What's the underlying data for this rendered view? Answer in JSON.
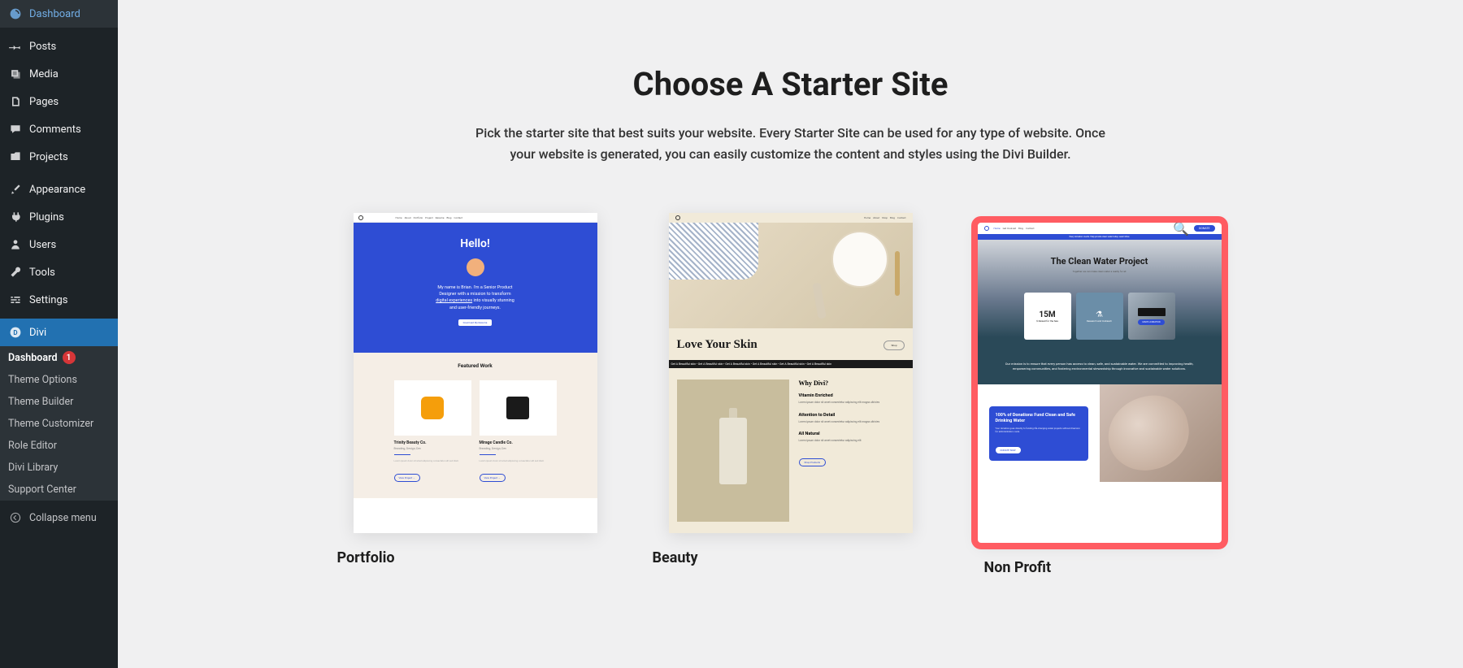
{
  "sidebar": {
    "items": [
      {
        "label": "Dashboard",
        "icon": "gauge"
      },
      {
        "label": "Posts",
        "icon": "pin"
      },
      {
        "label": "Media",
        "icon": "media"
      },
      {
        "label": "Pages",
        "icon": "pages"
      },
      {
        "label": "Comments",
        "icon": "comment"
      },
      {
        "label": "Projects",
        "icon": "projects"
      },
      {
        "label": "Appearance",
        "icon": "brush"
      },
      {
        "label": "Plugins",
        "icon": "plug"
      },
      {
        "label": "Users",
        "icon": "user"
      },
      {
        "label": "Tools",
        "icon": "wrench"
      },
      {
        "label": "Settings",
        "icon": "sliders"
      },
      {
        "label": "Divi",
        "icon": "divi"
      }
    ],
    "submenu": [
      {
        "label": "Dashboard",
        "badge": "1"
      },
      {
        "label": "Theme Options"
      },
      {
        "label": "Theme Builder"
      },
      {
        "label": "Theme Customizer"
      },
      {
        "label": "Role Editor"
      },
      {
        "label": "Divi Library"
      },
      {
        "label": "Support Center"
      }
    ],
    "collapse": "Collapse menu"
  },
  "page": {
    "title": "Choose A Starter Site",
    "description": "Pick the starter site that best suits your website. Every Starter Site can be used for any type of website. Once your website is generated, you can easily customize the content and styles using the Divi Builder."
  },
  "cards": [
    {
      "label": "Portfolio",
      "selected": false
    },
    {
      "label": "Beauty",
      "selected": false
    },
    {
      "label": "Non Profit",
      "selected": true
    }
  ],
  "thumb_portfolio": {
    "nav": [
      "Home",
      "About",
      "Portfolio",
      "Project",
      "Resume",
      "Blog",
      "Contact"
    ],
    "hello": "Hello!",
    "intro1": "My name is Brian. I'm a Senior Product",
    "intro2": "Designer with a mission to transform",
    "intro_link": "digital experiences",
    "intro3": " into visually stunning",
    "intro4": "and user-friendly journeys.",
    "hero_btn": "Download My Resume",
    "featured_title": "Featured Work",
    "col1_title": "Trinity Beauty Co.",
    "col1_sub": "Branding, Design, Dev",
    "col2_title": "Mirage Candle Co.",
    "col2_sub": "Branding, Design, Dev",
    "view_btn": "View Project →"
  },
  "thumb_beauty": {
    "nav": [
      "Home",
      "About",
      "Shop",
      "Blog",
      "Contact"
    ],
    "title": "Love Your Skin",
    "shop_btn": "Shop",
    "marquee": "Get A Beautiful skin • Get A Beautiful skin • Get A Beautiful skin • Get A Beautiful skin • Get A Beautiful skin • Get A Beautiful skin",
    "why": "Why Divi?",
    "f1": "Vitamin Enriched",
    "f2": "Attention to Detail",
    "f3": "All Natural",
    "btn": "Shop Products"
  },
  "thumb_nonprofit": {
    "nav": [
      "Home",
      "Get Involved",
      "Blog",
      "Contact"
    ],
    "donate": "DONATE",
    "bar": "Every donation counts. Help provide clean water today. Learn More",
    "title": "The Clean Water Project",
    "sub": "Together we can make clean water a reality for all",
    "stat_value": "15M",
    "stat_label": "$ Raised for the Sea",
    "card2_title": "Research and Outreach",
    "card3_btn": "MAKE A DONATION",
    "mission": "Our mission is to ensure that every person has access to clean, safe, and sustainable water. We are committed to improving health, empowering communities, and fostering environmental stewardship through innovative and sustainable water solutions.",
    "cta_title": "100% of Donations Fund Clean and Safe Drinking Water",
    "cta_text": "Your donation goes directly to funding life-changing water projects without diversion for administration costs.",
    "cta_btn": "DONATE NOW"
  }
}
